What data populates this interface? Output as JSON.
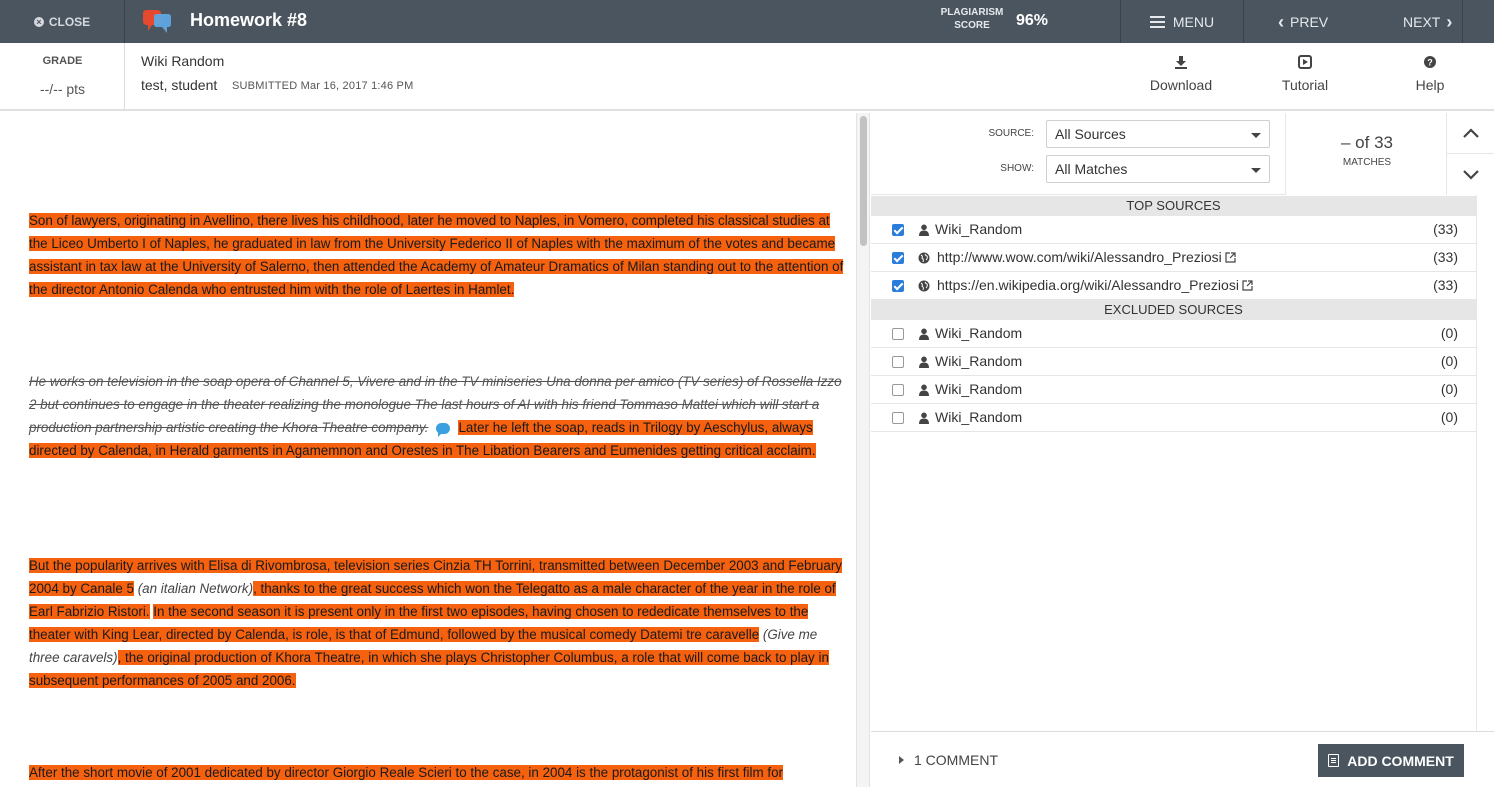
{
  "topbar": {
    "close_label": "CLOSE",
    "title": "Homework #8",
    "plagiarism_label_1": "PLAGIARISM",
    "plagiarism_label_2": "SCORE",
    "plagiarism_score": "96%",
    "menu_label": "MENU",
    "prev_label": "PREV",
    "next_label": "NEXT"
  },
  "subheader": {
    "grade_label": "GRADE",
    "grade_value": "--/-- pts",
    "assignment_name": "Wiki Random",
    "student_name": "test, student",
    "submitted_text": "SUBMITTED Mar 16, 2017 1:46 PM",
    "tools": {
      "download": "Download",
      "tutorial": "Tutorial",
      "help": "Help"
    }
  },
  "document": {
    "p1": "Son of lawyers, originating in Avellino, there lives his childhood, later he moved to Naples, in Vomero, completed his classical studies at the Liceo Umberto I of Naples, he graduated in law from the University Federico II of Naples with the maximum of the votes and became assistant in tax law at the University of Salerno, then attended the Academy of Amateur Dramatics of Milan standing out to the attention of the director Antonio Calenda who entrusted him with the role of Laertes in Hamlet.",
    "p2_struck": "He works on television in the soap opera of Channel 5, Vivere and in the TV miniseries Una donna per amico (TV series) of Rossella Izzo 2 but continues to engage in the theater realizing the monologue The last hours of AI with his friend Tommaso Mattei which will start a production partnership artistic creating the Khora Theatre company.",
    "p2_highlight": "Later he left the soap, reads in Trilogy by Aeschylus, always directed by Calenda, in Herald garments in Agamemnon and Orestes in The Libation Bearers and Eumenides getting critical acclaim.",
    "p3_a": "But the popularity arrives with Elisa di Rivombrosa, television series Cinzia TH Torrini, transmitted between December 2003 and February 2004 by Canale 5",
    "p3_note1": "(an italian Network)",
    "p3_b": ", thanks to the great success which won the Telegatto as a male character of the year in the role of Earl Fabrizio Ristori.",
    "p3_c": "In the second season it is present only in the first two episodes, having chosen to rededicate themselves to the theater with King Lear, directed by Calenda, is role, is that of Edmund, followed by the musical comedy Datemi tre caravelle",
    "p3_note2": "(Give me three caravels)",
    "p3_d": ", the original production of Khora Theatre, in which she plays Christopher Columbus, a role that will come back to play in subsequent performances of 2005 and 2006.",
    "p4": "After the short movie of 2001 dedicated by director Giorgio Reale Scieri to the case, in 2004 is the protagonist of his first film for"
  },
  "panel": {
    "source_label": "SOURCE:",
    "source_value": "All Sources",
    "show_label": "SHOW:",
    "show_value": "All Matches",
    "match_count": "– of 33",
    "match_label": "MATCHES",
    "top_sources_header": "TOP SOURCES",
    "excluded_sources_header": "EXCLUDED SOURCES",
    "top_sources": [
      {
        "name": "Wiki_Random",
        "count": "(33)",
        "icon": "user-icon",
        "checked": true
      },
      {
        "name": "http://www.wow.com/wiki/Alessandro_Preziosi",
        "count": "(33)",
        "icon": "globe-icon",
        "checked": true
      },
      {
        "name": "https://en.wikipedia.org/wiki/Alessandro_Preziosi",
        "count": "(33)",
        "icon": "globe-icon",
        "checked": true
      }
    ],
    "excluded_sources": [
      {
        "name": "Wiki_Random",
        "count": "(0)",
        "icon": "user-icon",
        "checked": false
      },
      {
        "name": "Wiki_Random",
        "count": "(0)",
        "icon": "user-icon",
        "checked": false
      },
      {
        "name": "Wiki_Random",
        "count": "(0)",
        "icon": "user-icon",
        "checked": false
      },
      {
        "name": "Wiki_Random",
        "count": "(0)",
        "icon": "user-icon",
        "checked": false
      }
    ],
    "comment_toggle": "1 COMMENT",
    "add_comment": "ADD COMMENT"
  },
  "colors": {
    "topbar": "#4b5560",
    "highlight": "#f5610f",
    "checkbox": "#2b7ddb",
    "comment_bubble": "#3aa0e0"
  }
}
